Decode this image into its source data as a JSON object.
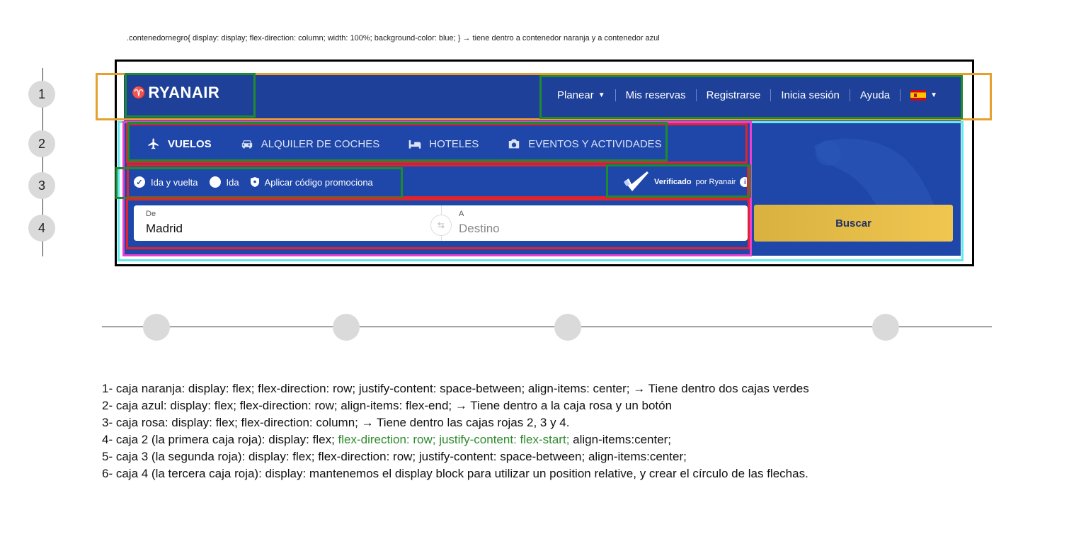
{
  "top_note": ".contenedornegro{ display: display; flex-direction: column; width: 100%; background-color: blue; }  → tiene dentro a contenedor  naranja y a contenedor azul",
  "steps": [
    "1",
    "2",
    "3",
    "4"
  ],
  "header": {
    "logo": "RYANAIR",
    "nav": [
      "Planear",
      "Mis reservas",
      "Registrarse",
      "Inicia sesión",
      "Ayuda"
    ]
  },
  "tabs": [
    "VUELOS",
    "ALQUILER DE COCHES",
    "HOTELES",
    "EVENTOS Y ACTIVIDADES"
  ],
  "options": [
    "Ida y vuelta",
    "Ida",
    "Aplicar código promociona"
  ],
  "verified": {
    "bold": "Verificado",
    "rest": "por Ryanair"
  },
  "search": {
    "from_label": "De",
    "from_value": "Madrid",
    "to_label": "A",
    "to_placeholder": "Destino",
    "button": "Buscar"
  },
  "notes": [
    "1- caja naranja: display: flex; flex-direction: row; justify-content: space-between; align-items: center; → Tiene dentro dos cajas verdes",
    "2- caja azul: display: flex; flex-direction: row; align-items: flex-end; → Tiene dentro a la caja rosa y un botón",
    "3- caja rosa: display: flex; flex-direction: column; → Tiene dentro las cajas rojas 2, 3 y 4.",
    "4- caja 2 (la primera caja roja): display: flex; ",
    "flex-direction: row; justify-content: flex-start;",
    " align-items:center;",
    "5- caja 3 (la segunda roja): display: flex; flex-direction: row; justify-content: space-between; align-items:center;",
    "6- caja 4 (la tercera caja roja): display: mantenemos el display block para utilizar un position relative, y crear el círculo de las flechas."
  ],
  "colors": {
    "orange": "#e7a02d",
    "green": "#1f8a2f",
    "cyan": "#5ee8f0",
    "pink": "#ea3fcf",
    "red": "#e0242f",
    "brand_blue": "#1f47a9",
    "button_yellow": "#f0c650"
  }
}
